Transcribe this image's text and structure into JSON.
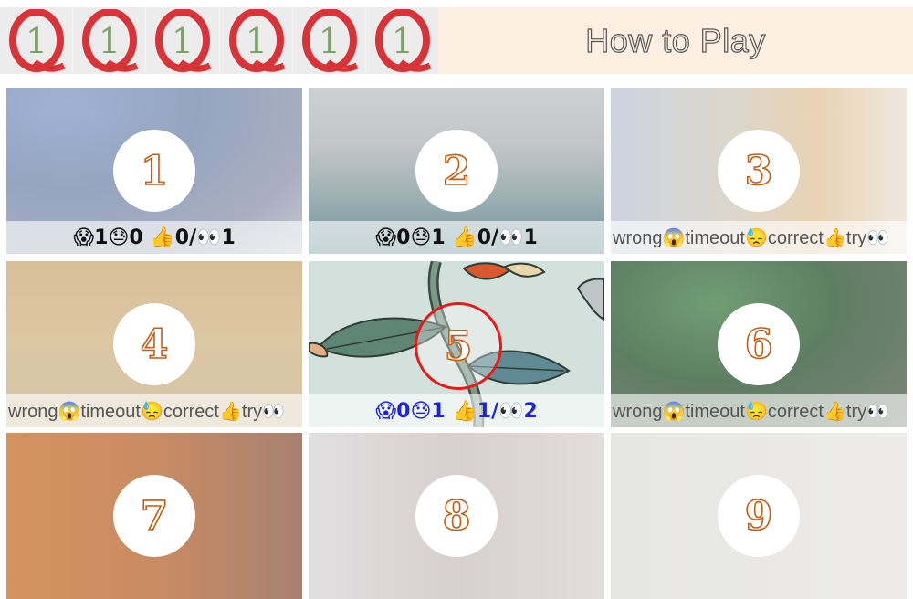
{
  "header": {
    "logo_count": 6,
    "logo_letter": "Q",
    "logo_digit": "1",
    "how_to_play": "How to Play",
    "colors": {
      "logo_red": "#d7343a",
      "logo_green": "#7e9f6a",
      "howto_bg": "#fdf0e3"
    }
  },
  "tiles": [
    {
      "number": "1",
      "wrong": "😱1",
      "timeout": "😓0",
      "correct": "👍0",
      "slash": "/",
      "tries": "👀1"
    },
    {
      "number": "2",
      "wrong": "😱0",
      "timeout": "😓1",
      "correct": "👍0",
      "slash": "/",
      "tries": "👀1"
    },
    {
      "number": "3",
      "legend": "wrong😱timeout😓correct👍try👀"
    },
    {
      "number": "4",
      "legend": "wrong😱timeout😓correct👍try👀"
    },
    {
      "number": "5",
      "wrong": "😱0",
      "timeout": "😓1",
      "correct": "👍1",
      "slash": "/",
      "tries": "👀2"
    },
    {
      "number": "6",
      "legend": "wrong😱timeout😓correct👍try👀"
    },
    {
      "number": "7"
    },
    {
      "number": "8"
    },
    {
      "number": "9"
    }
  ]
}
